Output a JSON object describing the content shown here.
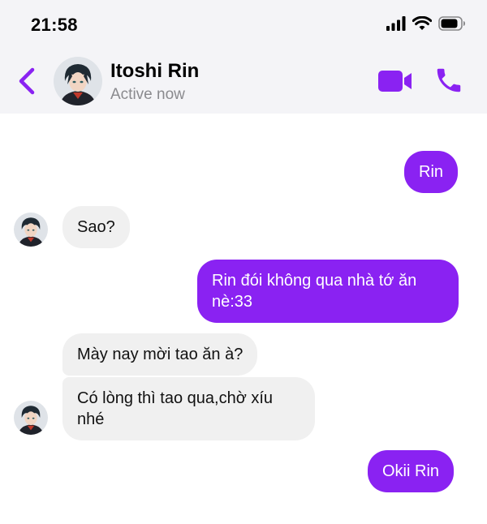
{
  "status_bar": {
    "time": "21:58",
    "icons": [
      "cellular-signal-icon",
      "wifi-icon",
      "battery-icon"
    ]
  },
  "header": {
    "back_icon": "chevron-left-icon",
    "contact_name": "Itoshi Rin",
    "contact_status": "Active now",
    "actions": [
      "video-call-icon",
      "phone-icon"
    ]
  },
  "colors": {
    "accent": "#8a22f2",
    "incoming_bubble": "#f0f0f0",
    "header_bg": "#f4f4f7",
    "status_text": "#8a8a8e"
  },
  "messages": [
    {
      "sender": "me",
      "text": "Rin"
    },
    {
      "sender": "contact",
      "text": "Sao?"
    },
    {
      "sender": "me",
      "text": "Rin đói không qua nhà tớ ăn nè:33"
    },
    {
      "sender": "contact",
      "text": "Mày nay mời tao ăn à?"
    },
    {
      "sender": "contact",
      "text": "Có lòng thì tao qua,chờ xíu nhé"
    },
    {
      "sender": "me",
      "text": "Okii Rin"
    }
  ]
}
